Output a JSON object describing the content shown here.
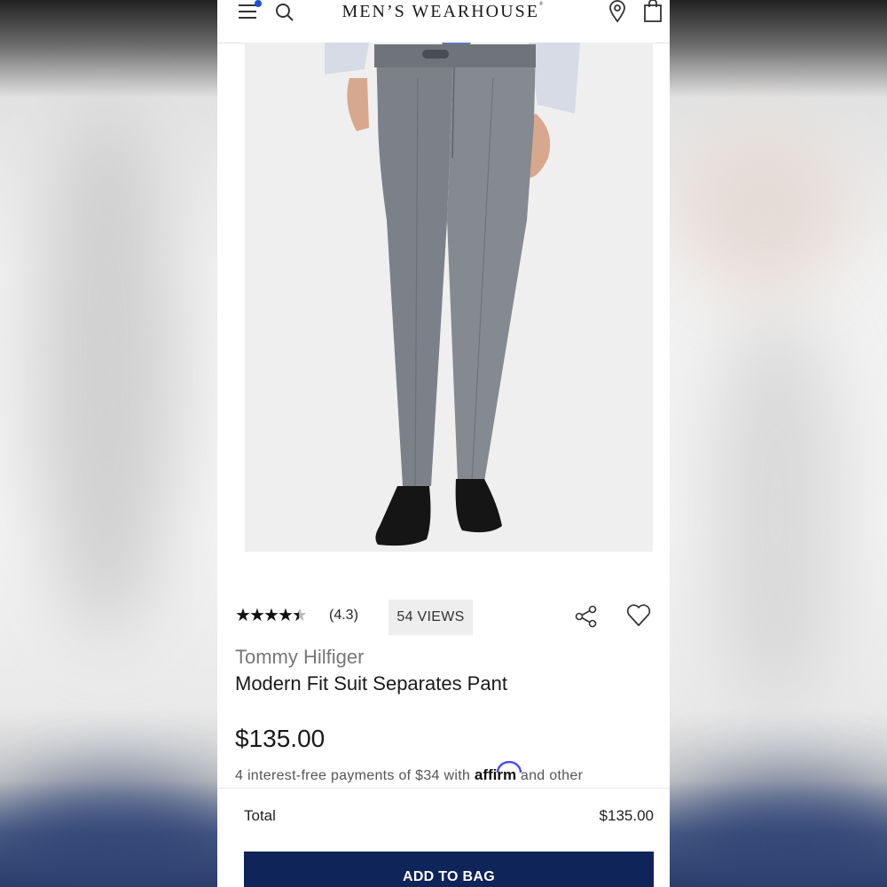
{
  "header": {
    "logo_text": "MEN’S WEARHOUSE",
    "logo_mark": "®",
    "menu_icon": "hamburger-menu-icon",
    "search_icon": "search-icon",
    "location_icon": "location-pin-icon",
    "bag_icon": "shopping-bag-icon",
    "notification_color": "#1a4fd6"
  },
  "product": {
    "image_alt": "Grey suit pants on model",
    "rating_stars": 4.5,
    "rating_text": "(4.3)",
    "views_text": "54 VIEWS",
    "brand": "Tommy Hilfiger",
    "name": "Modern Fit Suit Separates Pant",
    "price": "$135.00",
    "installments_prefix": "4 interest-free payments of $34 with",
    "affirm": "affirm",
    "installments_suffix": "and other"
  },
  "actions": {
    "share_icon": "share-icon",
    "wishlist_icon": "heart-icon"
  },
  "footer": {
    "total_label": "Total",
    "total_value": "$135.00",
    "add_to_bag_label": "ADD TO BAG",
    "button_color": "#0f2459"
  }
}
